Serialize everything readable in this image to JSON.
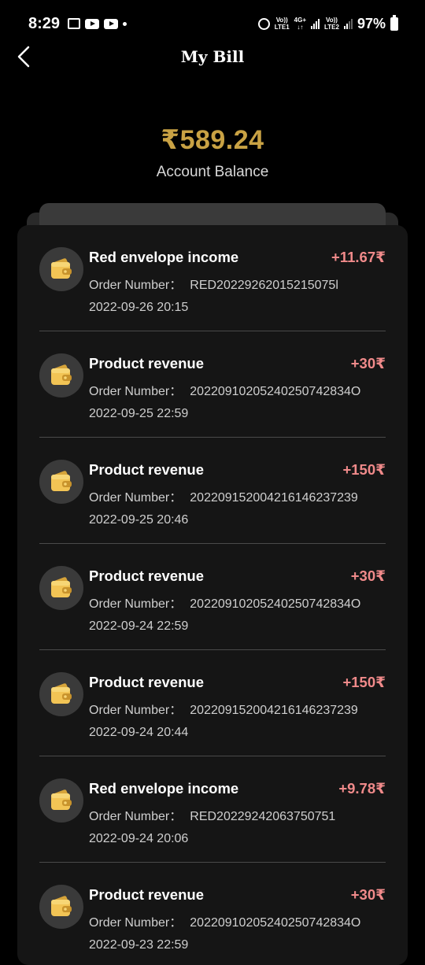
{
  "status_bar": {
    "time": "8:29",
    "sim1_label_top": "Vo))",
    "sim1_label_bottom": "LTE1",
    "net_label_top": "4G+",
    "net_label_bottom": "↓↑",
    "sim2_label_top": "Vo))",
    "sim2_label_bottom": "LTE2",
    "battery": "97%"
  },
  "header": {
    "title": "My Bill"
  },
  "balance": {
    "amount": "₹589.24",
    "label": "Account Balance"
  },
  "colors": {
    "accent_gold": "#c9a244",
    "amount_positive": "#f08a8a",
    "card_bg": "#151515"
  },
  "transactions": [
    {
      "title": "Red envelope income",
      "amount": "+11.67₹",
      "order_label": "Order Number：",
      "order_number": "RED20229262015215075l",
      "time": "2022-09-26 20:15"
    },
    {
      "title": "Product revenue",
      "amount": "+30₹",
      "order_label": "Order Number：",
      "order_number": "20220910205240250742834O",
      "time": "2022-09-25 22:59"
    },
    {
      "title": "Product revenue",
      "amount": "+150₹",
      "order_label": "Order Number：",
      "order_number": "20220915200421614623723​9",
      "time": "2022-09-25 20:46"
    },
    {
      "title": "Product revenue",
      "amount": "+30₹",
      "order_label": "Order Number：",
      "order_number": "20220910205240250742834O",
      "time": "2022-09-24 22:59"
    },
    {
      "title": "Product revenue",
      "amount": "+150₹",
      "order_label": "Order Number：",
      "order_number": "20220915200421614623723​9",
      "time": "2022-09-24 20:44"
    },
    {
      "title": "Red envelope income",
      "amount": "+9.78₹",
      "order_label": "Order Number：",
      "order_number": "RED20229242063750751",
      "time": "2022-09-24 20:06"
    },
    {
      "title": "Product revenue",
      "amount": "+30₹",
      "order_label": "Order Number：",
      "order_number": "20220910205240250742834O",
      "time": "2022-09-23 22:59"
    }
  ]
}
